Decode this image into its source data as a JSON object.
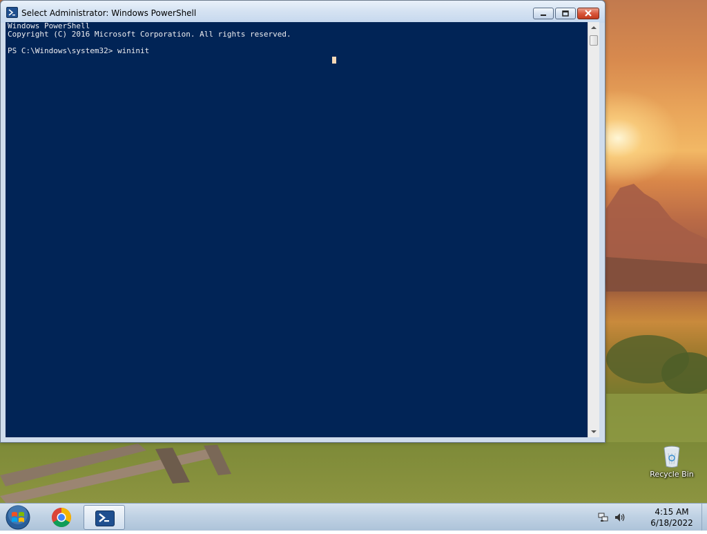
{
  "window": {
    "title": "Select Administrator: Windows PowerShell"
  },
  "console": {
    "lines": [
      "Windows PowerShell",
      "Copyright (C) 2016 Microsoft Corporation. All rights reserved.",
      "PS C:\\Windows\\system32> wininit"
    ]
  },
  "desktop": {
    "recycle_bin_label": "Recycle Bin"
  },
  "taskbar": {
    "items": [
      "start-orb",
      "chrome",
      "windows-powershell"
    ],
    "clock_time": "4:15 AM",
    "clock_date": "6/18/2022"
  },
  "colors": {
    "console_background": "#012456",
    "console_text": "#eeedf0",
    "cursor": "#f5d8b6",
    "close_button": "#c23a1d"
  }
}
